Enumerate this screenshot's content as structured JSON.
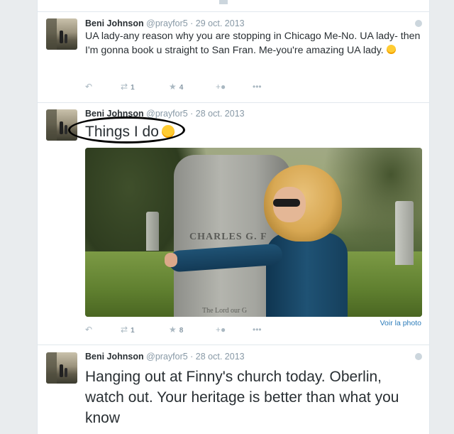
{
  "tweets": [
    {
      "fullname": "Beni Johnson",
      "username": "@prayfor5",
      "sep": " · ",
      "date": "29 oct. 2013",
      "text": "UA lady-any reason why you are stopping in Chicago Me-No. UA lady- then I'm gonna book u straight to San Fran. Me-you're amazing UA lady.",
      "retweets": "1",
      "favorites": "4"
    },
    {
      "fullname": "Beni Johnson",
      "username": "@prayfor5",
      "sep": " · ",
      "date": "28 oct. 2013",
      "text": "Things I do",
      "photo_engraving": "CHARLES G. F",
      "photo_engraving2": "The Lord our G",
      "view_photo": "Voir la photo",
      "retweets": "1",
      "favorites": "8"
    },
    {
      "fullname": "Beni Johnson",
      "username": "@prayfor5",
      "sep": " · ",
      "date": "28 oct. 2013",
      "text": "Hanging out at Finny's church today. Oberlin, watch out. Your heritage is better than what you know"
    }
  ],
  "icons": {
    "reply": "reply-icon",
    "retweet": "retweet-icon",
    "favorite": "star-icon",
    "follow": "follow-icon",
    "more": "more-icon",
    "gear": "gear-icon",
    "emoji": "smiley-emoji-icon"
  },
  "colors": {
    "link": "#2b7bb9",
    "meta": "#8899a6",
    "action": "#aab8c2",
    "annotation": "#000000"
  }
}
